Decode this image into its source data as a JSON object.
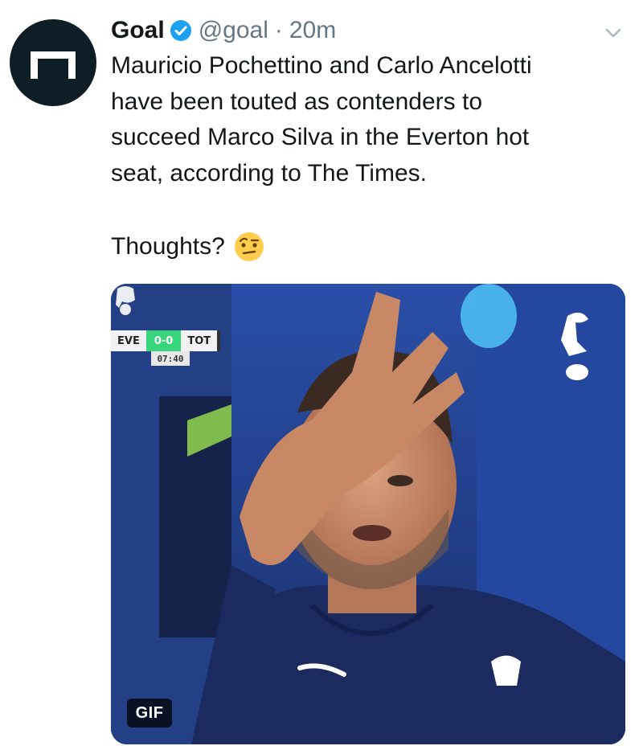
{
  "tweet": {
    "display_name": "Goal",
    "handle": "@goal",
    "separator": "·",
    "time": "20m",
    "text": "Mauricio Pochettino and Carlo Ancelotti\nhave been touted as contenders to\nsucceed Marco Silva in the Everton hot\nseat, according to The Times.",
    "thoughts": "Thoughts?",
    "emoji": "face-with-raised-eyebrow-icon"
  },
  "media": {
    "badge": "GIF",
    "scorebug": {
      "home": "EVE",
      "score": "0-0",
      "away": "TOT",
      "clock": "07:40"
    }
  },
  "icons": {
    "avatar": "goal-logo-icon",
    "verified": "verified-badge-icon",
    "menu": "chevron-down-icon",
    "club_crest": "cockerel-crest-icon",
    "league_logo": "lion-logo-icon"
  },
  "colors": {
    "avatar_bg": "#0f1d26",
    "verified_blue": "#1da1f2",
    "secondary_text": "#657786",
    "primary_text": "#14171a",
    "kit_navy": "#1d2c5e",
    "score_green": "#38d67a"
  }
}
